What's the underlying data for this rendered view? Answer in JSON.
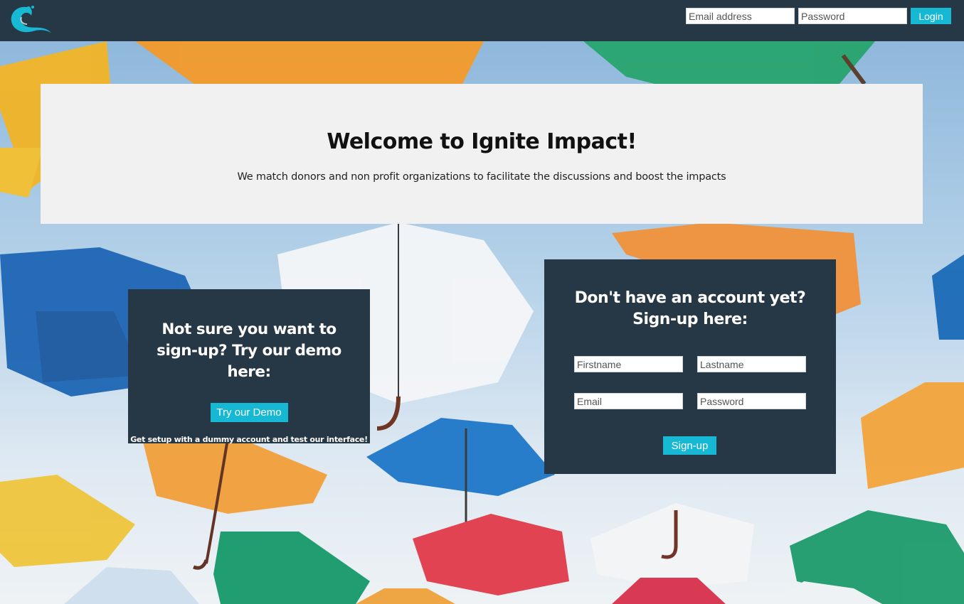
{
  "navbar": {
    "logo_icon": "wave-logo-icon",
    "email_placeholder": "Email address",
    "password_placeholder": "Password",
    "login_label": "Login"
  },
  "hero": {
    "title": "Welcome to Ignite Impact!",
    "subtitle": "We match donors and non profit organizations to facilitate the discussions and boost the impacts"
  },
  "demo": {
    "heading": "Not sure you want to sign-up? Try our demo here:",
    "button_label": "Try our Demo",
    "note": "Get setup with a dummy account and test our interface!"
  },
  "signup": {
    "heading_line1": "Don't have an account yet?",
    "heading_line2": "Sign-up here:",
    "firstname_placeholder": "Firstname",
    "lastname_placeholder": "Lastname",
    "email_placeholder": "Email",
    "password_placeholder": "Password",
    "button_label": "Sign-up"
  },
  "colors": {
    "nav_bg": "#263746",
    "panel_bg": "#263746",
    "accent": "#17b8d3",
    "hero_bg": "#f1f1f1"
  },
  "background": {
    "image": "colorful-umbrellas-photo"
  }
}
